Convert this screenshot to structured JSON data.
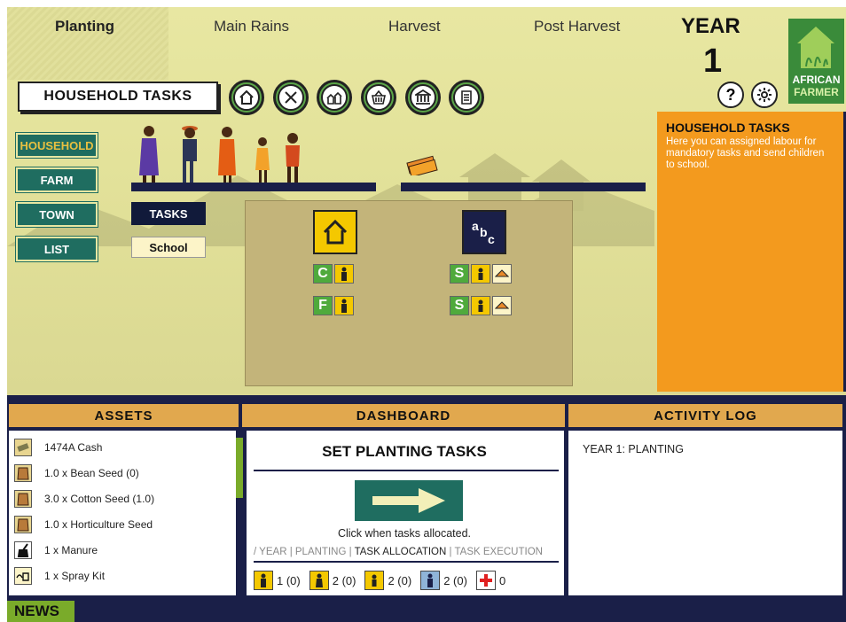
{
  "seasons": {
    "planting": "Planting",
    "main_rains": "Main Rains",
    "harvest": "Harvest",
    "post_harvest": "Post Harvest"
  },
  "year": {
    "label": "YEAR",
    "value": "1"
  },
  "logo": {
    "line1": "AFRICAN",
    "line2": "FARMER"
  },
  "header": {
    "title": "HOUSEHOLD TASKS"
  },
  "toolbar_icons": [
    "home-icon",
    "tools-icon",
    "village-icon",
    "market-basket-icon",
    "bank-icon",
    "notebook-icon"
  ],
  "help": {
    "label": "?"
  },
  "nav": {
    "household": "HOUSEHOLD",
    "farm": "FARM",
    "town": "TOWN",
    "list": "LIST"
  },
  "subnav": {
    "tasks": "TASKS",
    "school": "School"
  },
  "task_panel": {
    "home_chips": [
      {
        "letter": "C"
      },
      {
        "letter": "F"
      }
    ],
    "school_chips": [
      {
        "letter": "S"
      },
      {
        "letter": "S"
      }
    ],
    "school_icon_text": "abc"
  },
  "info_panel": {
    "title": "HOUSEHOLD TASKS",
    "text": "Here you can assigned labour for mandatory tasks and send children to school."
  },
  "assets": {
    "header": "ASSETS",
    "items": [
      {
        "label": "1474A Cash",
        "icon": "cash-icon"
      },
      {
        "label": "1.0 x Bean Seed (0)",
        "icon": "seed-bag-icon"
      },
      {
        "label": "3.0 x Cotton Seed (1.0)",
        "icon": "seed-bag-icon"
      },
      {
        "label": "1.0 x Horticulture Seed",
        "icon": "seed-bag-icon"
      },
      {
        "label": "1 x Manure",
        "icon": "manure-icon"
      },
      {
        "label": "1 x Spray Kit",
        "icon": "spray-kit-icon"
      }
    ]
  },
  "dashboard": {
    "header": "DASHBOARD",
    "title": "SET PLANTING TASKS",
    "caption": "Click when tasks allocated.",
    "phase_prefix": "/ YEAR | PLANTING | ",
    "phase_current": "TASK ALLOCATION",
    "phase_suffix": " | TASK EXECUTION",
    "labour": [
      {
        "value": "1 (0)",
        "icon": "adult-male-icon",
        "color": "#f4c800"
      },
      {
        "value": "2 (0)",
        "icon": "adult-female-icon",
        "color": "#f4c800"
      },
      {
        "value": "2 (0)",
        "icon": "child-icon",
        "color": "#f4c800"
      },
      {
        "value": "2 (0)",
        "icon": "hired-worker-icon",
        "color": "#8fb4d8"
      },
      {
        "value": "0",
        "icon": "health-cross-icon",
        "color": "#ffffff"
      }
    ]
  },
  "activity_log": {
    "header": "ACTIVITY LOG",
    "entry": "YEAR 1: PLANTING"
  },
  "news": {
    "label": "NEWS"
  }
}
